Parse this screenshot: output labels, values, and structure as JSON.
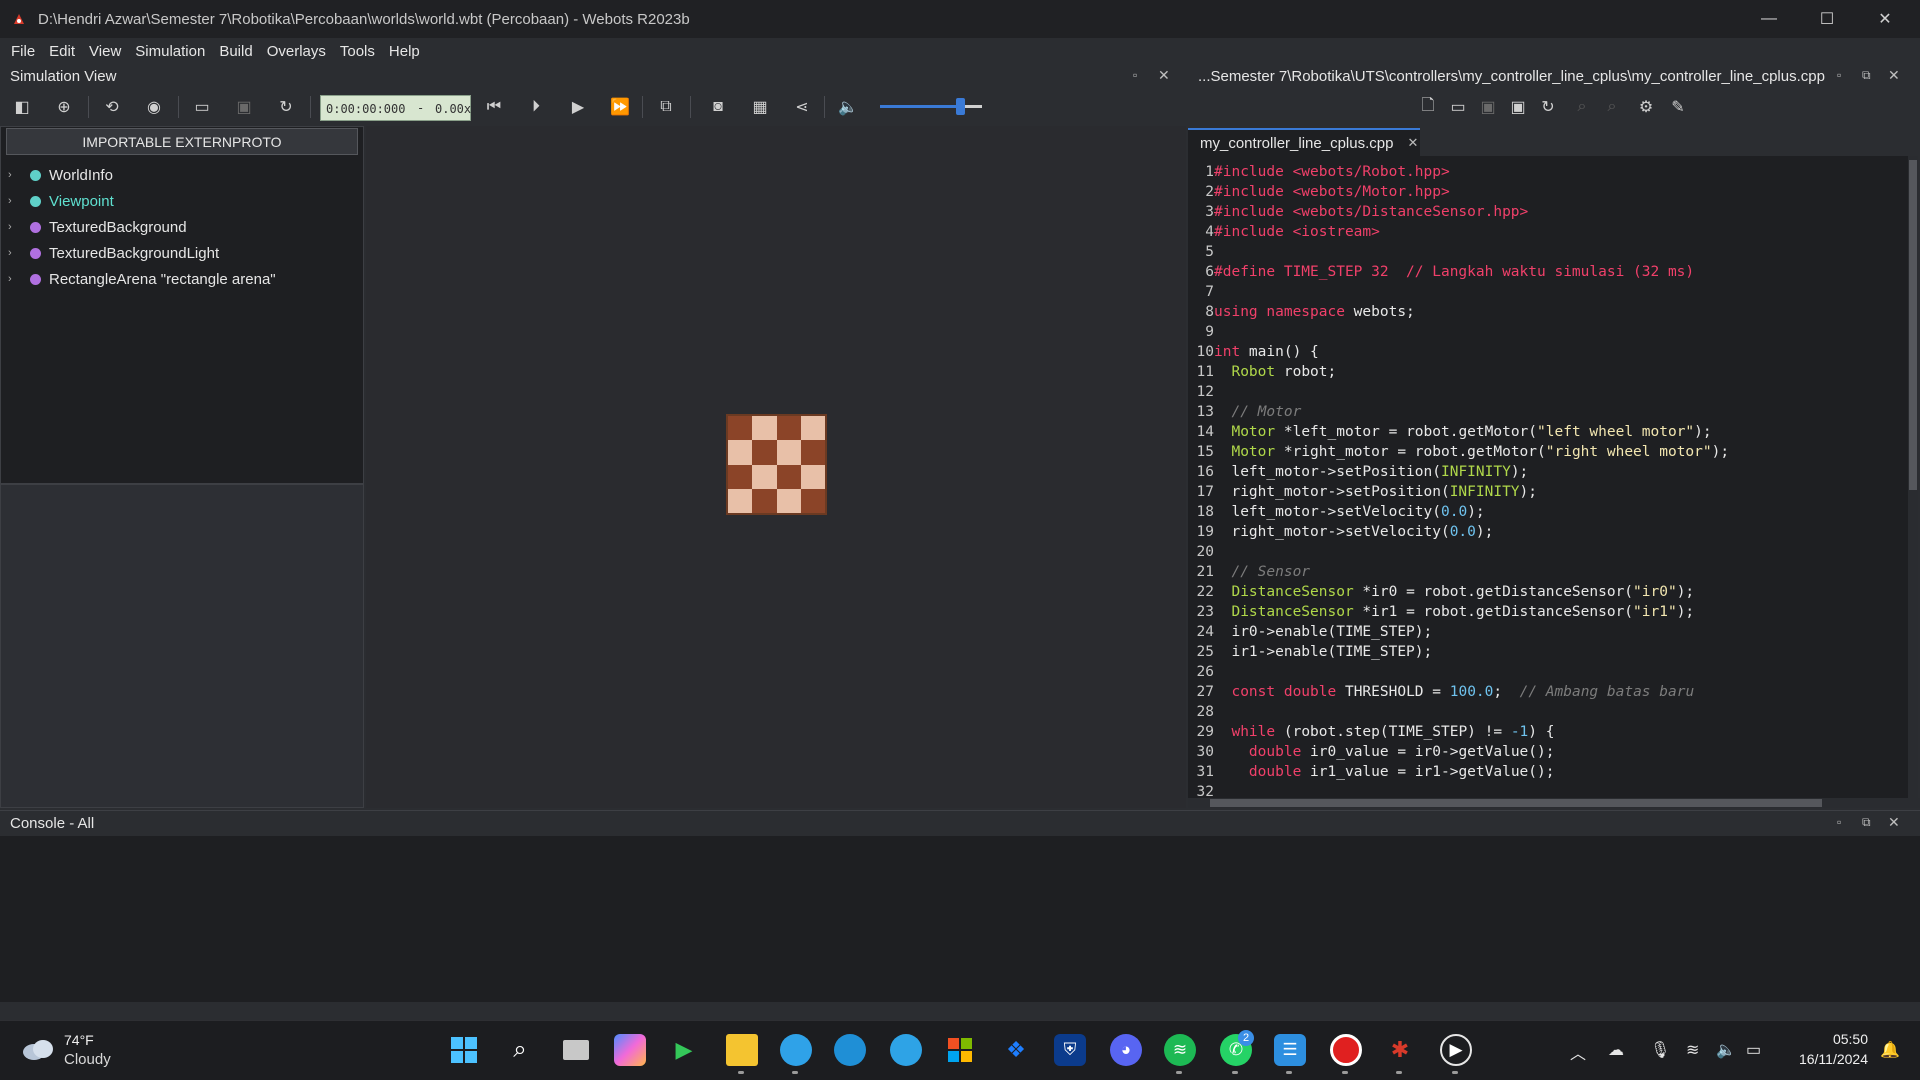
{
  "window": {
    "title": "D:\\Hendri Azwar\\Semester 7\\Robotika\\Percobaan\\worlds\\world.wbt (Percobaan) - Webots R2023b",
    "minimize": "—",
    "maximize": "☐",
    "close": "✕"
  },
  "menu": [
    "File",
    "Edit",
    "View",
    "Simulation",
    "Build",
    "Overlays",
    "Tools",
    "Help"
  ],
  "simulation_view": {
    "title": "Simulation View",
    "time": "0:00:00:000",
    "separator": "-",
    "speed": "0.00x",
    "volume_level": 0.78
  },
  "scene_tree": {
    "importable_button": "IMPORTABLE EXTERNPROTO",
    "items": [
      {
        "label": "WorldInfo",
        "color": "#5fd0c8",
        "highlight": false
      },
      {
        "label": "Viewpoint",
        "color": "#5fd0c8",
        "highlight": true
      },
      {
        "label": "TexturedBackground",
        "color": "#b070e0",
        "highlight": false
      },
      {
        "label": "TexturedBackgroundLight",
        "color": "#b070e0",
        "highlight": false
      },
      {
        "label": "RectangleArena \"rectangle arena\"",
        "color": "#b070e0",
        "highlight": false
      }
    ]
  },
  "editor": {
    "path": "...Semester 7\\Robotika\\UTS\\controllers\\my_controller_line_cplus\\my_controller_line_cplus.cpp",
    "tab_label": "my_controller_line_cplus.cpp",
    "tab_close": "✕",
    "lines": [
      {
        "n": "1",
        "t": [
          [
            "pp",
            "#include <webots/Robot.hpp>"
          ]
        ]
      },
      {
        "n": "2",
        "t": [
          [
            "pp",
            "#include <webots/Motor.hpp>"
          ]
        ]
      },
      {
        "n": "3",
        "t": [
          [
            "pp",
            "#include <webots/DistanceSensor.hpp>"
          ]
        ]
      },
      {
        "n": "4",
        "t": [
          [
            "pp",
            "#include <iostream>"
          ]
        ]
      },
      {
        "n": "5",
        "t": []
      },
      {
        "n": "6",
        "t": [
          [
            "pp",
            "#define TIME_STEP 32  // Langkah waktu simulasi (32 ms)"
          ]
        ]
      },
      {
        "n": "7",
        "t": []
      },
      {
        "n": "8",
        "t": [
          [
            "kw",
            "using namespace"
          ],
          [
            "df",
            " webots;"
          ]
        ]
      },
      {
        "n": "9",
        "t": []
      },
      {
        "n": "10",
        "t": [
          [
            "kw",
            "int"
          ],
          [
            "df",
            " main() {"
          ]
        ]
      },
      {
        "n": "11",
        "t": [
          [
            "df",
            "  "
          ],
          [
            "ty",
            "Robot"
          ],
          [
            "df",
            " robot;"
          ]
        ]
      },
      {
        "n": "12",
        "t": []
      },
      {
        "n": "13",
        "t": [
          [
            "df",
            "  "
          ],
          [
            "cm",
            "// Motor"
          ]
        ]
      },
      {
        "n": "14",
        "t": [
          [
            "df",
            "  "
          ],
          [
            "ty",
            "Motor"
          ],
          [
            "df",
            " *left_motor = robot.getMotor("
          ],
          [
            "st",
            "\"left wheel motor\""
          ],
          [
            "df",
            ");"
          ]
        ]
      },
      {
        "n": "15",
        "t": [
          [
            "df",
            "  "
          ],
          [
            "ty",
            "Motor"
          ],
          [
            "df",
            " *right_motor = robot.getMotor("
          ],
          [
            "st",
            "\"right wheel motor\""
          ],
          [
            "df",
            ");"
          ]
        ]
      },
      {
        "n": "16",
        "t": [
          [
            "df",
            "  left_motor->setPosition("
          ],
          [
            "ty",
            "INFINITY"
          ],
          [
            "df",
            ");"
          ]
        ]
      },
      {
        "n": "17",
        "t": [
          [
            "df",
            "  right_motor->setPosition("
          ],
          [
            "ty",
            "INFINITY"
          ],
          [
            "df",
            ");"
          ]
        ]
      },
      {
        "n": "18",
        "t": [
          [
            "df",
            "  left_motor->setVelocity("
          ],
          [
            "nm",
            "0.0"
          ],
          [
            "df",
            ");"
          ]
        ]
      },
      {
        "n": "19",
        "t": [
          [
            "df",
            "  right_motor->setVelocity("
          ],
          [
            "nm",
            "0.0"
          ],
          [
            "df",
            ");"
          ]
        ]
      },
      {
        "n": "20",
        "t": []
      },
      {
        "n": "21",
        "t": [
          [
            "df",
            "  "
          ],
          [
            "cm",
            "// Sensor"
          ]
        ]
      },
      {
        "n": "22",
        "t": [
          [
            "df",
            "  "
          ],
          [
            "ty",
            "DistanceSensor"
          ],
          [
            "df",
            " *ir0 = robot.getDistanceSensor("
          ],
          [
            "st",
            "\"ir0\""
          ],
          [
            "df",
            ");"
          ]
        ]
      },
      {
        "n": "23",
        "t": [
          [
            "df",
            "  "
          ],
          [
            "ty",
            "DistanceSensor"
          ],
          [
            "df",
            " *ir1 = robot.getDistanceSensor("
          ],
          [
            "st",
            "\"ir1\""
          ],
          [
            "df",
            ");"
          ]
        ]
      },
      {
        "n": "24",
        "t": [
          [
            "df",
            "  ir0->enable(TIME_STEP);"
          ]
        ]
      },
      {
        "n": "25",
        "t": [
          [
            "df",
            "  ir1->enable(TIME_STEP);"
          ]
        ]
      },
      {
        "n": "26",
        "t": []
      },
      {
        "n": "27",
        "t": [
          [
            "df",
            "  "
          ],
          [
            "kw",
            "const double"
          ],
          [
            "df",
            " THRESHOLD = "
          ],
          [
            "nm",
            "100.0"
          ],
          [
            "df",
            ";  "
          ],
          [
            "cm",
            "// Ambang batas baru"
          ]
        ]
      },
      {
        "n": "28",
        "t": []
      },
      {
        "n": "29",
        "t": [
          [
            "df",
            "  "
          ],
          [
            "kw",
            "while"
          ],
          [
            "df",
            " (robot.step(TIME_STEP) != "
          ],
          [
            "nm",
            "-1"
          ],
          [
            "df",
            ") {"
          ]
        ]
      },
      {
        "n": "30",
        "t": [
          [
            "df",
            "    "
          ],
          [
            "kw",
            "double"
          ],
          [
            "df",
            " ir0_value = ir0->getValue();"
          ]
        ]
      },
      {
        "n": "31",
        "t": [
          [
            "df",
            "    "
          ],
          [
            "kw",
            "double"
          ],
          [
            "df",
            " ir1_value = ir1->getValue();"
          ]
        ]
      },
      {
        "n": "32",
        "t": []
      }
    ]
  },
  "console": {
    "title": "Console - All"
  },
  "taskbar": {
    "weather_temp": "74°F",
    "weather_desc": "Cloudy",
    "whatsapp_badge": "2",
    "time": "05:50",
    "date": "16/11/2024"
  },
  "colors": {
    "accent": "#3a7ad6",
    "time_box": "#d8e6d0"
  }
}
